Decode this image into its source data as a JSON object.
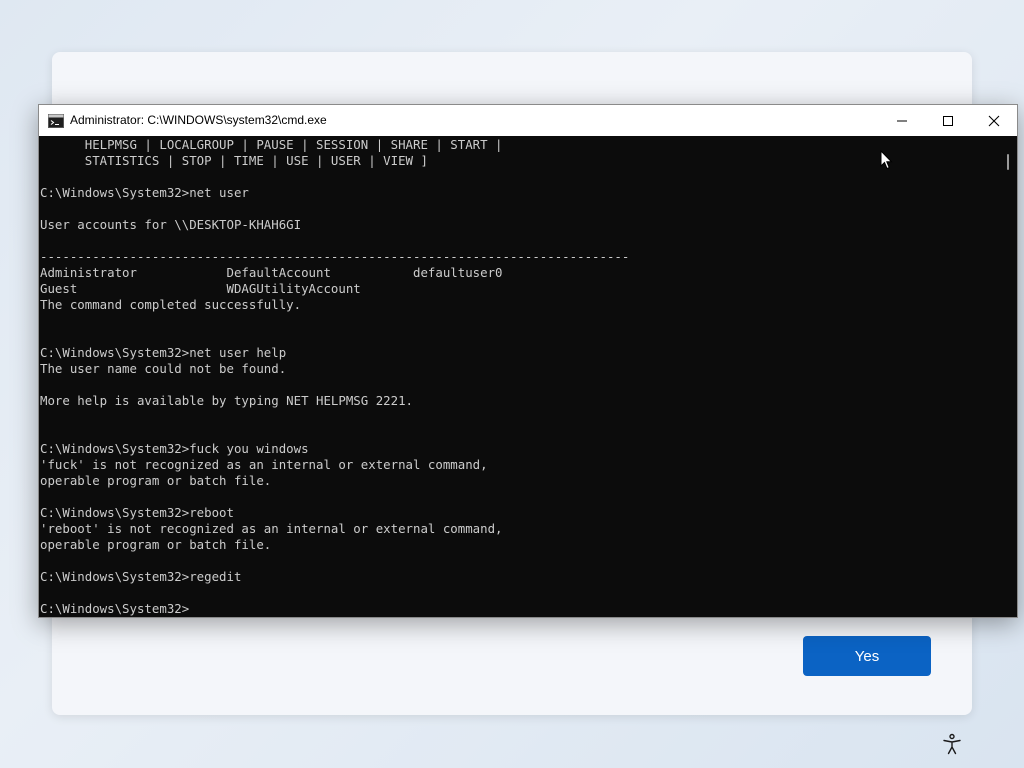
{
  "window": {
    "title": "Administrator: C:\\WINDOWS\\system32\\cmd.exe",
    "icon": "cmd-app-icon",
    "controls": {
      "minimize": "minimize-icon",
      "maximize": "maximize-icon",
      "close": "close-icon"
    }
  },
  "console": {
    "lines": [
      "      HELPMSG | LOCALGROUP | PAUSE | SESSION | SHARE | START |",
      "      STATISTICS | STOP | TIME | USE | USER | VIEW ]",
      "",
      "C:\\Windows\\System32>net user",
      "",
      "User accounts for \\\\DESKTOP-KHAH6GI",
      "",
      "-------------------------------------------------------------------------------",
      "Administrator            DefaultAccount           defaultuser0",
      "Guest                    WDAGUtilityAccount",
      "The command completed successfully.",
      "",
      "",
      "C:\\Windows\\System32>net user help",
      "The user name could not be found.",
      "",
      "More help is available by typing NET HELPMSG 2221.",
      "",
      "",
      "C:\\Windows\\System32>fuck you windows",
      "'fuck' is not recognized as an internal or external command,",
      "operable program or batch file.",
      "",
      "C:\\Windows\\System32>reboot",
      "'reboot' is not recognized as an internal or external command,",
      "operable program or batch file.",
      "",
      "C:\\Windows\\System32>regedit",
      "",
      "C:\\Windows\\System32>"
    ]
  },
  "oobe": {
    "yes_label": "Yes"
  },
  "colors": {
    "accent": "#0b63c4",
    "console_bg": "#0c0c0c",
    "console_fg": "#cccccc"
  },
  "icons": {
    "accessibility": "accessibility-icon",
    "cursor": "mouse-pointer-icon"
  }
}
